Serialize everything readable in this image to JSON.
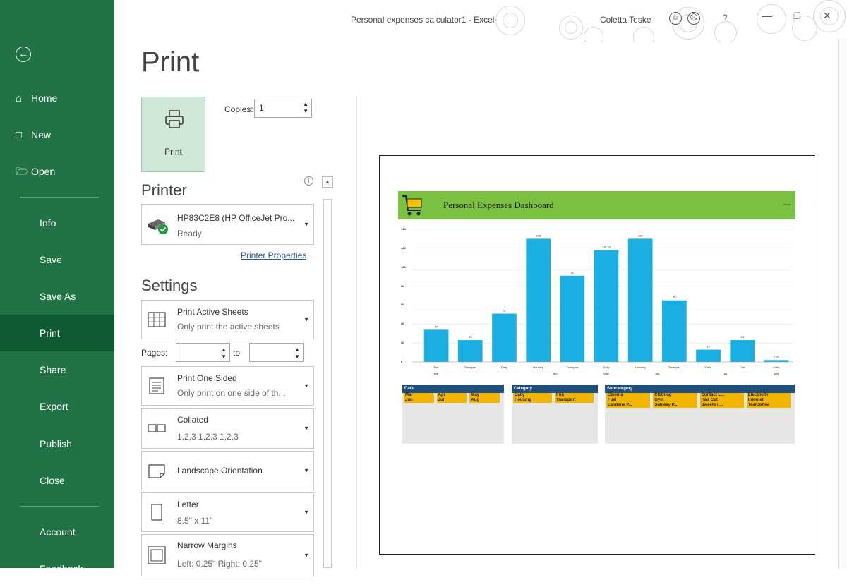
{
  "window": {
    "title": "Personal expenses calculator1  -  Excel",
    "user": "Coletta Teske",
    "help": "?",
    "colors": {
      "excel_green": "#217346",
      "active": "#0f5a33",
      "chart_bar": "#1aaee2",
      "dash_header": "#7ac142",
      "slicer_header": "#1f4e79",
      "slicer_item": "#f2b600"
    }
  },
  "sidebar": {
    "items": [
      {
        "label": "Home",
        "icon": "home-icon"
      },
      {
        "label": "New",
        "icon": "new-doc-icon"
      },
      {
        "label": "Open",
        "icon": "folder-icon"
      },
      {
        "label": "Info"
      },
      {
        "label": "Save"
      },
      {
        "label": "Save As"
      },
      {
        "label": "Print"
      },
      {
        "label": "Share"
      },
      {
        "label": "Export"
      },
      {
        "label": "Publish"
      },
      {
        "label": "Close"
      },
      {
        "label": "Account"
      },
      {
        "label": "Feedback"
      }
    ]
  },
  "print": {
    "heading": "Print",
    "button_label": "Print",
    "copies_label": "Copies:",
    "copies_value": "1"
  },
  "printer": {
    "heading": "Printer",
    "name": "HP83C2E8 (HP OfficeJet Pro...",
    "status": "Ready",
    "properties_link": "Printer Properties"
  },
  "settings": {
    "heading": "Settings",
    "active_sheets": {
      "title": "Print Active Sheets",
      "sub": "Only print the active sheets"
    },
    "pages_label": "Pages:",
    "to_label": "to",
    "sided": {
      "title": "Print One Sided",
      "sub": "Only print on one side of th..."
    },
    "collated": {
      "title": "Collated",
      "sub": "1,2,3   1,2,3   1,2,3"
    },
    "orientation": {
      "title": "Landscape Orientation"
    },
    "paper": {
      "title": "Letter",
      "sub": "8.5\" x 11\""
    },
    "margins": {
      "title": "Narrow Margins",
      "sub": "Left: 0.25\"   Right: 0.25\""
    }
  },
  "preview": {
    "dashboard_title": "Personal Expenses Dashboard",
    "slicers": [
      {
        "title": "Date",
        "items": [
          [
            "Mar",
            "Apr",
            "May"
          ],
          [
            "Jun",
            "Jul",
            "Aug"
          ]
        ]
      },
      {
        "title": "Category",
        "items": [
          [
            "Daily",
            "Fun"
          ],
          [
            "Housing",
            "Transport"
          ]
        ]
      },
      {
        "title": "Subcategory",
        "items": [
          [
            "Cinema",
            "Clothing",
            "Contact L...",
            "Electricity"
          ],
          [
            "Fuel",
            "Gym",
            "Hair Cut",
            "Internet"
          ],
          [
            "Landline P...",
            "Subway P...",
            "Sweets / ...",
            "Tea/Coffee"
          ]
        ]
      }
    ]
  },
  "chart_data": {
    "type": "bar",
    "categories": [
      "Fun",
      "Transport",
      "Daily",
      "Housing",
      "Transport",
      "Daily",
      "Housing",
      "Transport",
      "Daily",
      "Fun",
      "Daily"
    ],
    "groups": [
      "Mar",
      "",
      "Apr",
      "May",
      "Jun",
      "Jul",
      "Aug"
    ],
    "values": [
      34,
      23,
      51,
      130,
      91,
      118,
      130,
      65,
      13,
      23,
      2
    ],
    "value_labels": [
      "34",
      "23",
      "51",
      "130",
      "91",
      "118.33",
      "130",
      "65",
      "13",
      "23",
      "2.33"
    ],
    "yticks": [
      "140",
      "120",
      "100",
      "80",
      "60",
      "40",
      "20",
      "0"
    ],
    "ylim": [
      0,
      140
    ],
    "grid": true,
    "color": "#1aaee2"
  }
}
